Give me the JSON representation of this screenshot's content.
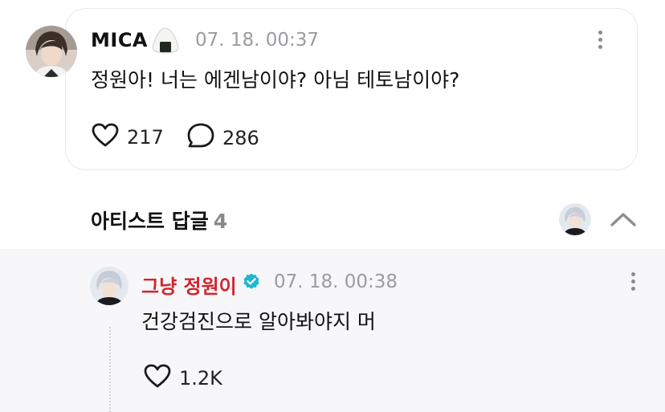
{
  "post": {
    "author": "MICA",
    "author_emoji_icon": "rice-ball-icon",
    "time": "07. 18. 00:37",
    "body": "정원아! 너는 에겐남이야? 아님 테토남이야?",
    "likes": "217",
    "comments": "286"
  },
  "artist_replies": {
    "title": "아티스트 답글",
    "count": "4"
  },
  "reply": {
    "author": "그냥 정원이",
    "verified": true,
    "time": "07. 18. 00:38",
    "body": "건강검진으로 알아봐야지 머",
    "likes": "1.2K"
  },
  "colors": {
    "artist_name": "#d4232c",
    "verified_badge": "#1fb6d4",
    "muted_text": "#9b9ba1",
    "reply_bg": "#f7f7f9"
  }
}
